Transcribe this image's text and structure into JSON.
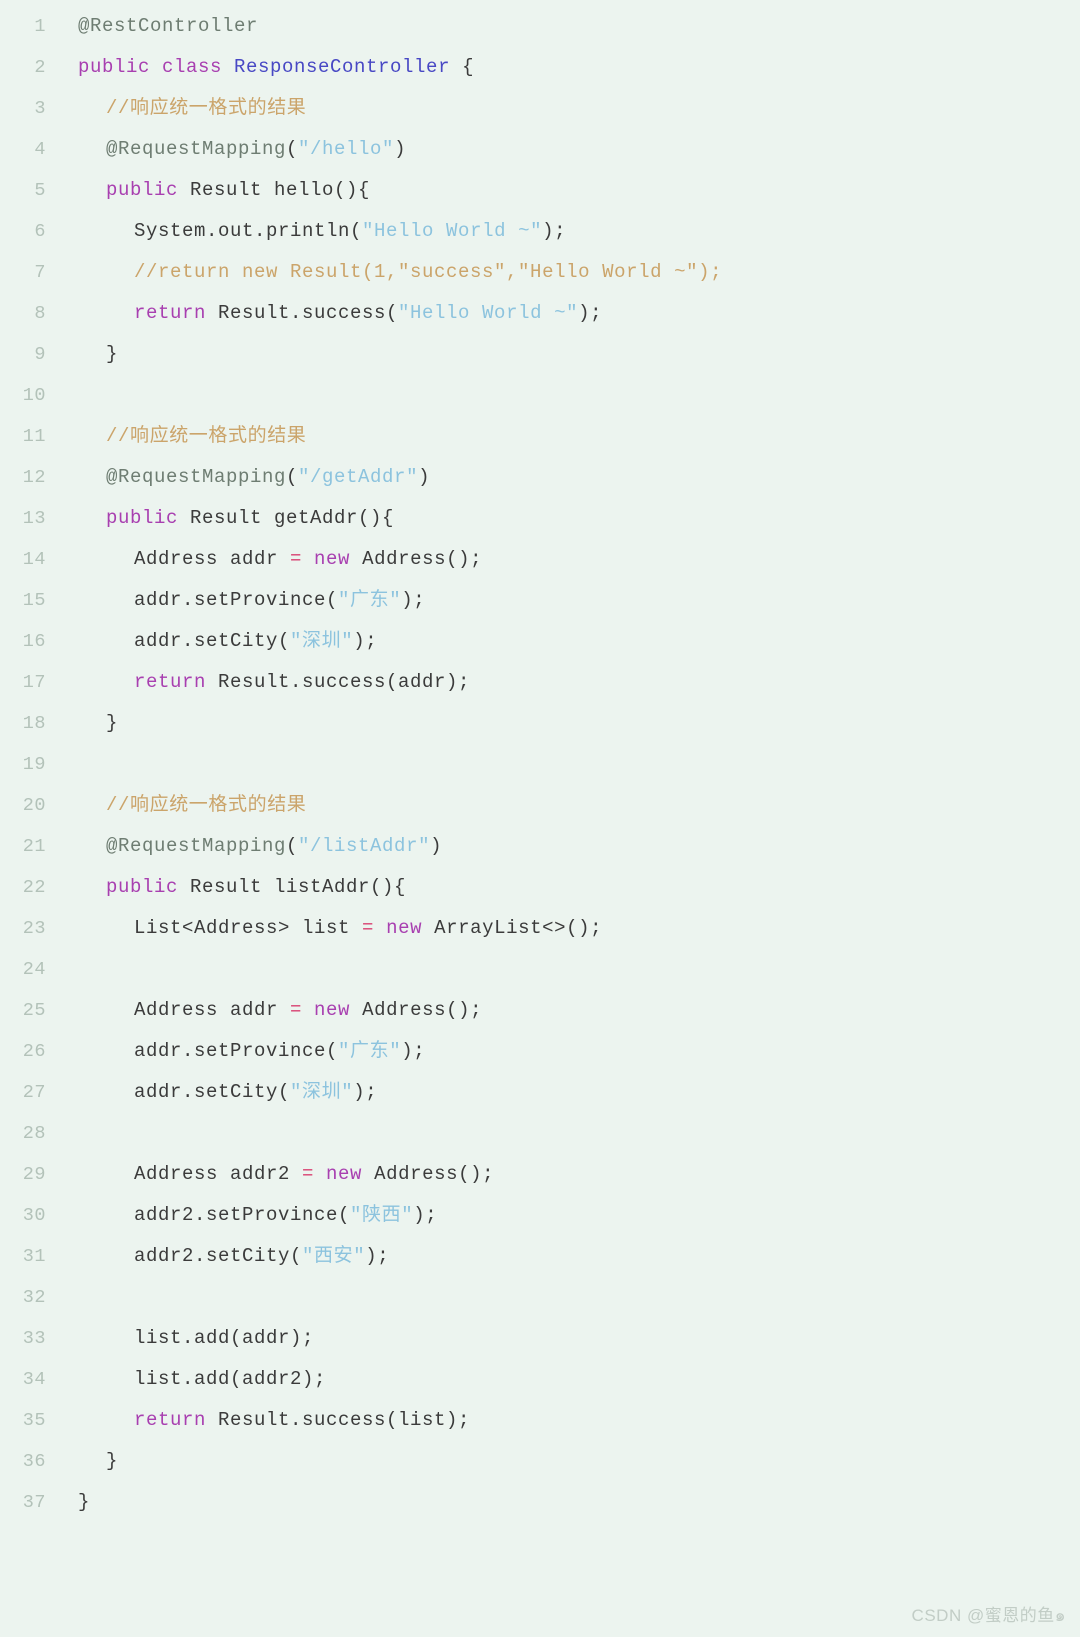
{
  "editor": {
    "language": "java",
    "background_color": "#ecf4ef",
    "line_number_color": "#b3c2b9",
    "total_lines": 37,
    "palette": {
      "keyword": "#a83fb0",
      "type": "#4848c4",
      "string": "#8cc3de",
      "comment": "#cba46a",
      "operator": "#d94070",
      "annotation": "#6e7d72",
      "default": "#3b3b3b"
    }
  },
  "watermark": {
    "text": "CSDN @蜜恩的鱼๑"
  },
  "lines": [
    {
      "n": "1",
      "indent": 0,
      "tokens": [
        {
          "t": "anno",
          "s": "@RestController"
        }
      ]
    },
    {
      "n": "2",
      "indent": 0,
      "tokens": [
        {
          "t": "keyword",
          "s": "public class "
        },
        {
          "t": "type",
          "s": "ResponseController"
        },
        {
          "t": "default",
          "s": " {"
        }
      ]
    },
    {
      "n": "3",
      "indent": 1,
      "tokens": [
        {
          "t": "comment",
          "s": "//响应统一格式的结果"
        }
      ]
    },
    {
      "n": "4",
      "indent": 1,
      "tokens": [
        {
          "t": "anno",
          "s": "@RequestMapping"
        },
        {
          "t": "default",
          "s": "("
        },
        {
          "t": "string",
          "s": "\"/hello\""
        },
        {
          "t": "default",
          "s": ")"
        }
      ]
    },
    {
      "n": "5",
      "indent": 1,
      "tokens": [
        {
          "t": "keyword",
          "s": "public "
        },
        {
          "t": "default",
          "s": "Result hello(){"
        }
      ]
    },
    {
      "n": "6",
      "indent": 2,
      "tokens": [
        {
          "t": "default",
          "s": "System.out.println("
        },
        {
          "t": "string",
          "s": "\"Hello World ~\""
        },
        {
          "t": "default",
          "s": ");"
        }
      ]
    },
    {
      "n": "7",
      "indent": 2,
      "tokens": [
        {
          "t": "comment",
          "s": "//return new Result(1,\"success\",\"Hello World ~\");"
        }
      ]
    },
    {
      "n": "8",
      "indent": 2,
      "tokens": [
        {
          "t": "keyword",
          "s": "return "
        },
        {
          "t": "default",
          "s": "Result.success("
        },
        {
          "t": "string",
          "s": "\"Hello World ~\""
        },
        {
          "t": "default",
          "s": ");"
        }
      ]
    },
    {
      "n": "9",
      "indent": 1,
      "tokens": [
        {
          "t": "default",
          "s": "}"
        }
      ]
    },
    {
      "n": "10",
      "indent": 0,
      "tokens": []
    },
    {
      "n": "11",
      "indent": 1,
      "tokens": [
        {
          "t": "comment",
          "s": "//响应统一格式的结果"
        }
      ]
    },
    {
      "n": "12",
      "indent": 1,
      "tokens": [
        {
          "t": "anno",
          "s": "@RequestMapping"
        },
        {
          "t": "default",
          "s": "("
        },
        {
          "t": "string",
          "s": "\"/getAddr\""
        },
        {
          "t": "default",
          "s": ")"
        }
      ]
    },
    {
      "n": "13",
      "indent": 1,
      "tokens": [
        {
          "t": "keyword",
          "s": "public "
        },
        {
          "t": "default",
          "s": "Result getAddr(){"
        }
      ]
    },
    {
      "n": "14",
      "indent": 2,
      "tokens": [
        {
          "t": "default",
          "s": "Address addr "
        },
        {
          "t": "operator",
          "s": "= "
        },
        {
          "t": "keyword",
          "s": "new "
        },
        {
          "t": "default",
          "s": "Address();"
        }
      ]
    },
    {
      "n": "15",
      "indent": 2,
      "tokens": [
        {
          "t": "default",
          "s": "addr.setProvince("
        },
        {
          "t": "string",
          "s": "\"广东\""
        },
        {
          "t": "default",
          "s": ");"
        }
      ]
    },
    {
      "n": "16",
      "indent": 2,
      "tokens": [
        {
          "t": "default",
          "s": "addr.setCity("
        },
        {
          "t": "string",
          "s": "\"深圳\""
        },
        {
          "t": "default",
          "s": ");"
        }
      ]
    },
    {
      "n": "17",
      "indent": 2,
      "tokens": [
        {
          "t": "keyword",
          "s": "return "
        },
        {
          "t": "default",
          "s": "Result.success(addr);"
        }
      ]
    },
    {
      "n": "18",
      "indent": 1,
      "tokens": [
        {
          "t": "default",
          "s": "}"
        }
      ]
    },
    {
      "n": "19",
      "indent": 0,
      "tokens": []
    },
    {
      "n": "20",
      "indent": 1,
      "tokens": [
        {
          "t": "comment",
          "s": "//响应统一格式的结果"
        }
      ]
    },
    {
      "n": "21",
      "indent": 1,
      "tokens": [
        {
          "t": "anno",
          "s": "@RequestMapping"
        },
        {
          "t": "default",
          "s": "("
        },
        {
          "t": "string",
          "s": "\"/listAddr\""
        },
        {
          "t": "default",
          "s": ")"
        }
      ]
    },
    {
      "n": "22",
      "indent": 1,
      "tokens": [
        {
          "t": "keyword",
          "s": "public "
        },
        {
          "t": "default",
          "s": "Result listAddr(){"
        }
      ]
    },
    {
      "n": "23",
      "indent": 2,
      "tokens": [
        {
          "t": "default",
          "s": "List<Address> list "
        },
        {
          "t": "operator",
          "s": "= "
        },
        {
          "t": "keyword",
          "s": "new "
        },
        {
          "t": "default",
          "s": "ArrayList<>();"
        }
      ]
    },
    {
      "n": "24",
      "indent": 0,
      "tokens": []
    },
    {
      "n": "25",
      "indent": 2,
      "tokens": [
        {
          "t": "default",
          "s": "Address addr "
        },
        {
          "t": "operator",
          "s": "= "
        },
        {
          "t": "keyword",
          "s": "new "
        },
        {
          "t": "default",
          "s": "Address();"
        }
      ]
    },
    {
      "n": "26",
      "indent": 2,
      "tokens": [
        {
          "t": "default",
          "s": "addr.setProvince("
        },
        {
          "t": "string",
          "s": "\"广东\""
        },
        {
          "t": "default",
          "s": ");"
        }
      ]
    },
    {
      "n": "27",
      "indent": 2,
      "tokens": [
        {
          "t": "default",
          "s": "addr.setCity("
        },
        {
          "t": "string",
          "s": "\"深圳\""
        },
        {
          "t": "default",
          "s": ");"
        }
      ]
    },
    {
      "n": "28",
      "indent": 0,
      "tokens": []
    },
    {
      "n": "29",
      "indent": 2,
      "tokens": [
        {
          "t": "default",
          "s": "Address addr2 "
        },
        {
          "t": "operator",
          "s": "= "
        },
        {
          "t": "keyword",
          "s": "new "
        },
        {
          "t": "default",
          "s": "Address();"
        }
      ]
    },
    {
      "n": "30",
      "indent": 2,
      "tokens": [
        {
          "t": "default",
          "s": "addr2.setProvince("
        },
        {
          "t": "string",
          "s": "\"陕西\""
        },
        {
          "t": "default",
          "s": ");"
        }
      ]
    },
    {
      "n": "31",
      "indent": 2,
      "tokens": [
        {
          "t": "default",
          "s": "addr2.setCity("
        },
        {
          "t": "string",
          "s": "\"西安\""
        },
        {
          "t": "default",
          "s": ");"
        }
      ]
    },
    {
      "n": "32",
      "indent": 0,
      "tokens": []
    },
    {
      "n": "33",
      "indent": 2,
      "tokens": [
        {
          "t": "default",
          "s": "list.add(addr);"
        }
      ]
    },
    {
      "n": "34",
      "indent": 2,
      "tokens": [
        {
          "t": "default",
          "s": "list.add(addr2);"
        }
      ]
    },
    {
      "n": "35",
      "indent": 2,
      "tokens": [
        {
          "t": "keyword",
          "s": "return "
        },
        {
          "t": "default",
          "s": "Result.success(list);"
        }
      ]
    },
    {
      "n": "36",
      "indent": 1,
      "tokens": [
        {
          "t": "default",
          "s": "}"
        }
      ]
    },
    {
      "n": "37",
      "indent": 0,
      "tokens": [
        {
          "t": "default",
          "s": "}"
        }
      ]
    }
  ]
}
